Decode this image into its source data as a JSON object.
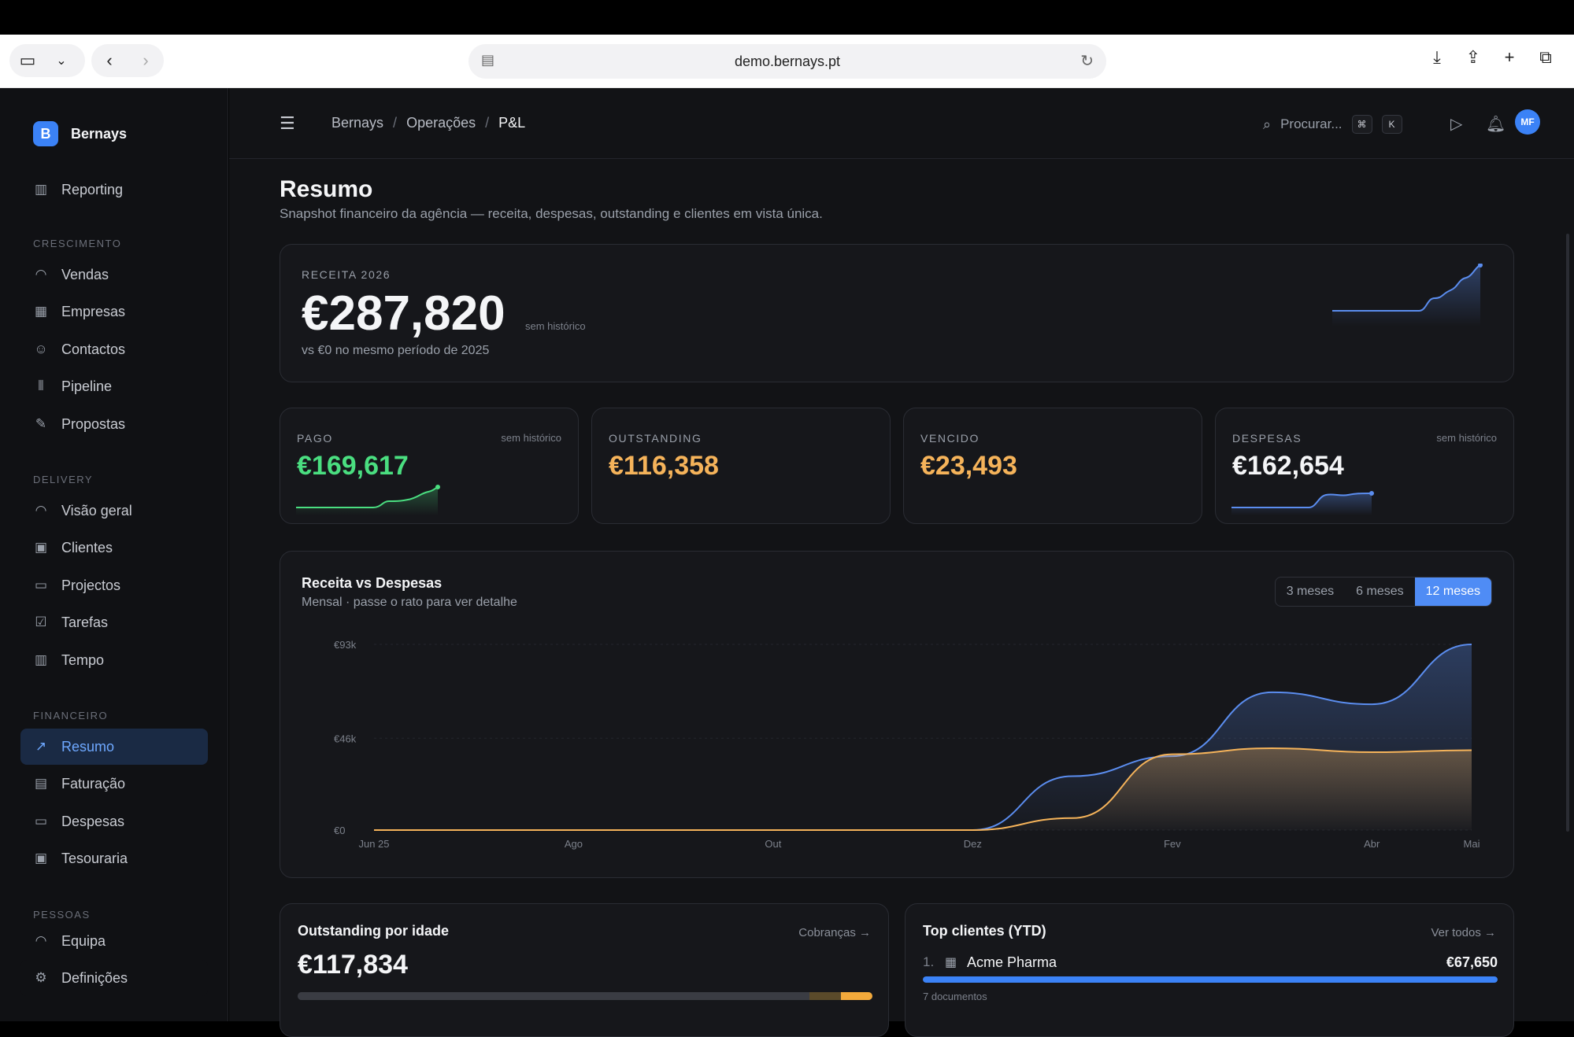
{
  "browser": {
    "url": "demo.bernays.pt"
  },
  "sidebar": {
    "brand_initial": "B",
    "brand_name": "Bernays",
    "top_item": "Reporting",
    "sections": [
      {
        "title": "CRESCIMENTO",
        "items": [
          "Vendas",
          "Empresas",
          "Contactos",
          "Pipeline",
          "Propostas"
        ]
      },
      {
        "title": "DELIVERY",
        "items": [
          "Visão geral",
          "Clientes",
          "Projectos",
          "Tarefas",
          "Tempo"
        ]
      },
      {
        "title": "FINANCEIRO",
        "items": [
          "Resumo",
          "Faturação",
          "Despesas",
          "Tesouraria"
        ]
      },
      {
        "title": "PESSOAS",
        "items": [
          "Equipa"
        ]
      }
    ],
    "active_item": "Resumo",
    "settings": "Definições"
  },
  "header": {
    "breadcrumb": [
      "Bernays",
      "Operações",
      "P&L"
    ],
    "search_placeholder": "Procurar...",
    "search_kbd": [
      "⌘",
      "K"
    ],
    "avatar_initials": "MF"
  },
  "page": {
    "title": "Resumo",
    "subtitle": "Snapshot financeiro da agência — receita, despesas, outstanding e clientes em vista única."
  },
  "revenue": {
    "label": "RECEITA 2026",
    "value": "€287,820",
    "no_history": "sem histórico",
    "comparison": "vs €0 no mesmo período de 2025",
    "spark_color": "#5b8def"
  },
  "kpis": [
    {
      "label": "PAGO",
      "value": "€169,617",
      "note": "sem histórico",
      "color": "#4ade80",
      "spark": true
    },
    {
      "label": "OUTSTANDING",
      "value": "€116,358",
      "note": "",
      "color": "#f5b35a",
      "spark": false
    },
    {
      "label": "VENCIDO",
      "value": "€23,493",
      "note": "",
      "color": "#f5b35a",
      "spark": false
    },
    {
      "label": "DESPESAS",
      "value": "€162,654",
      "note": "sem histórico",
      "color": "#f4f5f7",
      "spark": true
    }
  ],
  "chart": {
    "title": "Receita vs Despesas",
    "subtitle": "Mensal · passe o rato para ver detalhe",
    "ranges": [
      "3 meses",
      "6 meses",
      "12 meses"
    ],
    "active_range": "12 meses"
  },
  "chart_data": {
    "type": "area",
    "x": [
      "Jun 25",
      "Jul",
      "Ago",
      "Set",
      "Out",
      "Nov",
      "Dez",
      "Jan",
      "Fev",
      "Mar",
      "Abr",
      "Mai"
    ],
    "x_tick_labels": [
      "Jun 25",
      "Ago",
      "Out",
      "Dez",
      "Fev",
      "Abr",
      "Mai"
    ],
    "y_tick_labels": [
      "€0",
      "€46k",
      "€93k"
    ],
    "ylim": [
      0,
      93000
    ],
    "series": [
      {
        "values": [
          0,
          0,
          0,
          0,
          0,
          0,
          0,
          27000,
          37000,
          69000,
          63000,
          93000
        ],
        "color": "#5b8def"
      },
      {
        "values": [
          0,
          0,
          0,
          0,
          0,
          0,
          0,
          6000,
          38000,
          41000,
          39000,
          40000
        ],
        "color": "#f5b35a"
      }
    ],
    "grid": true
  },
  "outstanding": {
    "title": "Outstanding por idade",
    "link": "Cobranças",
    "value": "€117,834",
    "buckets_fraction": [
      0.89,
      0.055,
      0.055
    ]
  },
  "top_clients": {
    "title": "Top clientes (YTD)",
    "link": "Ver todos",
    "items": [
      {
        "rank": "1.",
        "name": "Acme Pharma",
        "amount": "€67,650",
        "docs": "7 documentos",
        "share": 1.0
      }
    ]
  }
}
